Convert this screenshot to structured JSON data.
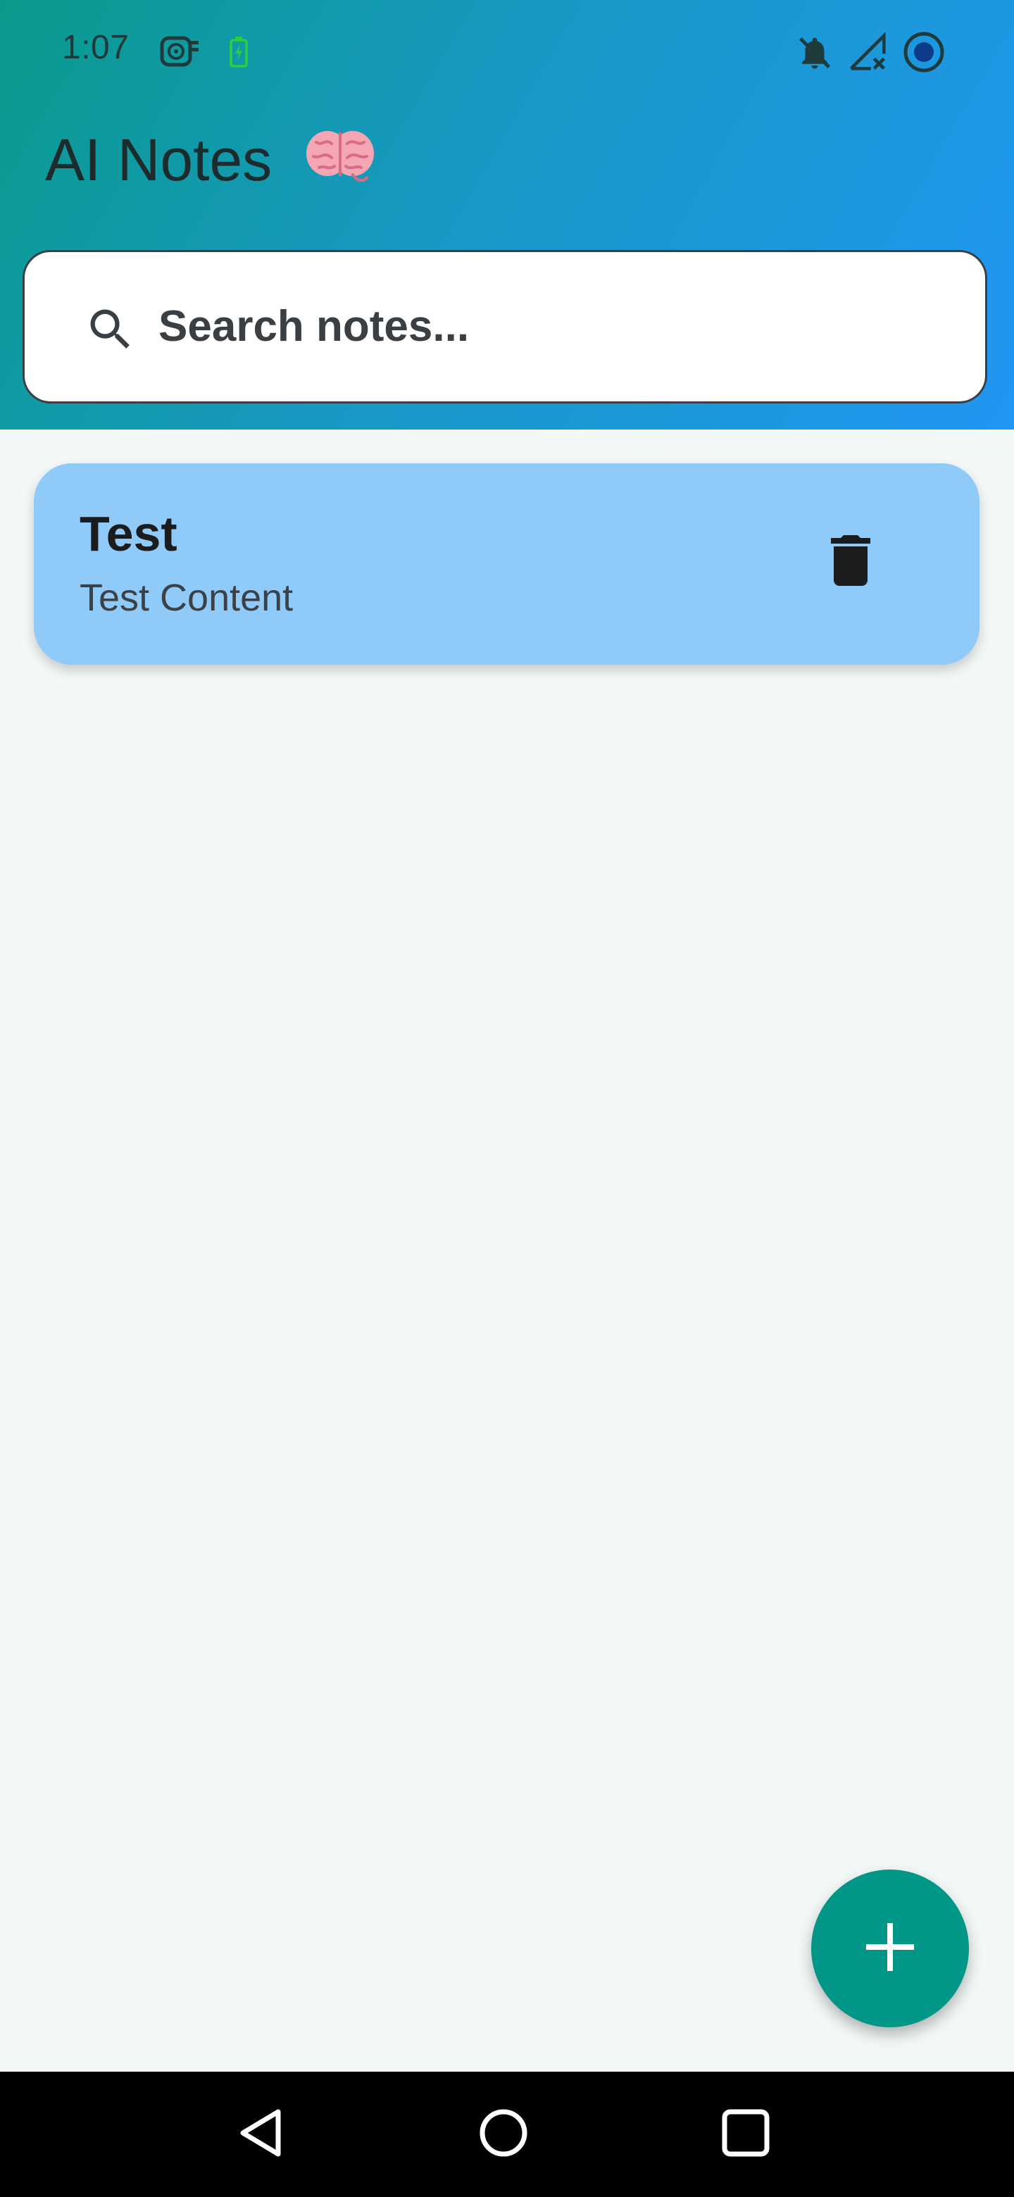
{
  "status_bar": {
    "time": "1:07",
    "icons": [
      "fan-icon",
      "battery-charging-icon",
      "notifications-off-icon",
      "no-signal-icon",
      "record-icon"
    ]
  },
  "app": {
    "title": "AI Notes",
    "title_icon": "brain-icon"
  },
  "search": {
    "placeholder": "Search notes...",
    "icon": "search-icon"
  },
  "notes": [
    {
      "title": "Test",
      "content": "Test Content",
      "action_icon": "trash-icon"
    }
  ],
  "fab": {
    "icon": "plus-icon"
  },
  "nav_bar": {
    "buttons": [
      "back-icon",
      "home-icon",
      "recents-icon"
    ]
  },
  "colors": {
    "header_gradient_start": "#0a9a8c",
    "header_gradient_end": "#2196f3",
    "note_card": "#90caf9",
    "fab": "#009688",
    "background": "#f2f8f7"
  }
}
